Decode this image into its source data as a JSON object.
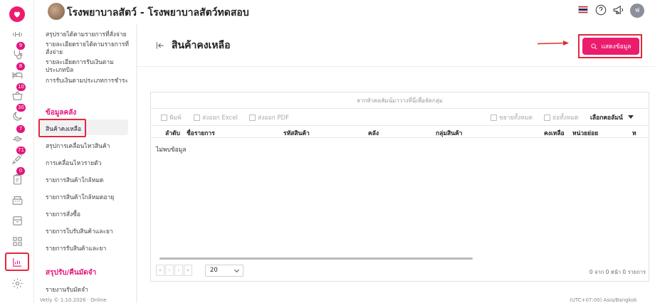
{
  "header": {
    "hospital_name": "โรงพยาบาลสัตว์ - โรงพยาบาลสัตว์ทดสอบ",
    "user_initial": "ฟ"
  },
  "rail": {
    "badges": [
      "9",
      "8",
      "10",
      "30",
      "7",
      "71",
      "0"
    ]
  },
  "menu": {
    "top_items": [
      "สรุปรายได้ตามรายการที่สั่งจ่าย",
      "รายละเอียดรายได้ตามรายการที่สั่งจ่าย",
      "รายละเอียดการรับเงินตามประเภทบิล",
      "การรับเงินตามประเภทการชำระ"
    ],
    "section_inventory": "ข้อมูลคลัง",
    "inventory_items": [
      "สินค้าคงเหลือ",
      "สรุปการเคลื่อนไหวสินค้า",
      "การเคลื่อนไหวรายตัว",
      "รายการสินค้าใกล้หมด",
      "รายการสินค้าใกล้หมดอายุ",
      "รายการสั่งซื้อ",
      "รายการใบรับสินค้าและยา",
      "รายการรับสินค้าและยา"
    ],
    "section_deposit": "สรุปรับ/คืนมัดจำ",
    "deposit_items": [
      "รายงานรับมัดจำ"
    ]
  },
  "page": {
    "title": "สินค้าคงเหลือ",
    "show_button": "แสดงข้อมูล"
  },
  "grid": {
    "group_hint": "ลากหัวคอลัมน์มาวางที่นี่เพื่อจัดกลุ่ม",
    "toolbar": {
      "print": "พิมพ์",
      "export_excel": "ส่งออก Excel",
      "export_pdf": "ส่งออก PDF",
      "expand_all": "ขยายทั้งหมด",
      "collapse_all": "ย่อทั้งหมด",
      "choose_columns": "เลือกคอลัมน์"
    },
    "columns": [
      "ลำดับ",
      "ชื่อรายการ",
      "รหัสสินค้า",
      "คลัง",
      "กลุ่มสินค้า",
      "คงเหลือ",
      "หน่วยย่อย",
      "ห"
    ],
    "no_data": "ไม่พบข้อมูล",
    "pager_buttons": [
      "«",
      "‹",
      "›",
      "»"
    ],
    "page_size": "20",
    "pager_info": "0 จาก 0 หน้า 0 รายการ"
  },
  "footer": {
    "left": "Vetly © 1.10.2026 · Online",
    "right": "(UTC+07:00) Asia/Bangkok"
  },
  "colors": {
    "accent": "#ec1c6c",
    "highlight_border": "#e5273a"
  }
}
